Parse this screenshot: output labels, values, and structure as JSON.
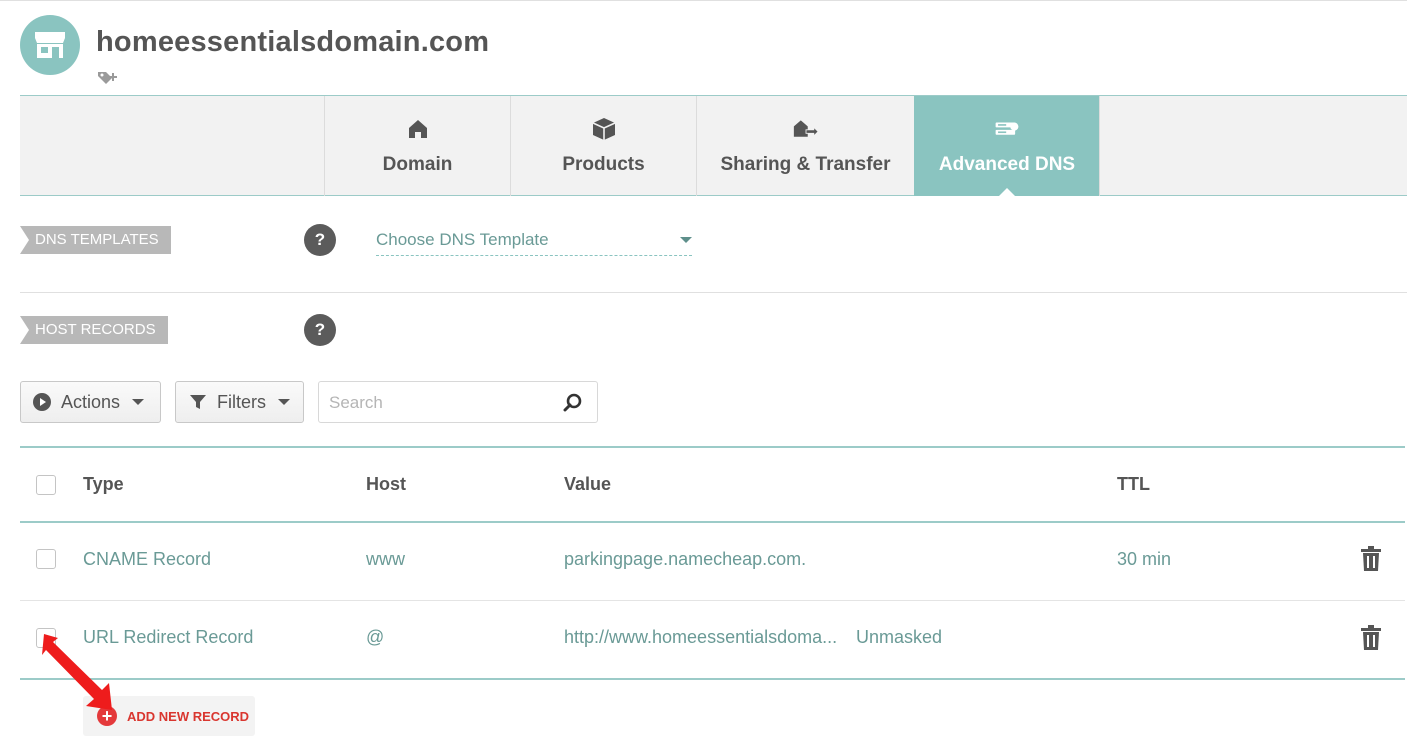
{
  "header": {
    "domain": "homeessentialsdomain.com",
    "avatar_icon": "storefront-icon",
    "tag_icon": "add-tag-icon",
    "accent_color": "#8ac4c0"
  },
  "tabs": [
    {
      "label": "Domain",
      "icon": "house-icon",
      "active": false
    },
    {
      "label": "Products",
      "icon": "box-icon",
      "active": false
    },
    {
      "label": "Sharing & Transfer",
      "icon": "house-transfer-icon",
      "active": false
    },
    {
      "label": "Advanced DNS",
      "icon": "server-icon",
      "active": true
    }
  ],
  "dns_templates": {
    "label": "DNS TEMPLATES",
    "help": "?",
    "select_value": "Choose DNS Template"
  },
  "host_records": {
    "label": "HOST RECORDS",
    "help": "?"
  },
  "toolbar": {
    "actions_label": "Actions",
    "filters_label": "Filters",
    "search_placeholder": "Search"
  },
  "table": {
    "columns": [
      "Type",
      "Host",
      "Value",
      "TTL"
    ],
    "rows": [
      {
        "type": "CNAME Record",
        "host": "www",
        "value": "parkingpage.namecheap.com.",
        "extra": "",
        "ttl": "30 min"
      },
      {
        "type": "URL Redirect Record",
        "host": "@",
        "value": "http://www.homeessentialsdoma...",
        "extra": "Unmasked",
        "ttl": ""
      }
    ]
  },
  "add_record": {
    "label": "ADD NEW RECORD",
    "color": "#e4393b"
  }
}
